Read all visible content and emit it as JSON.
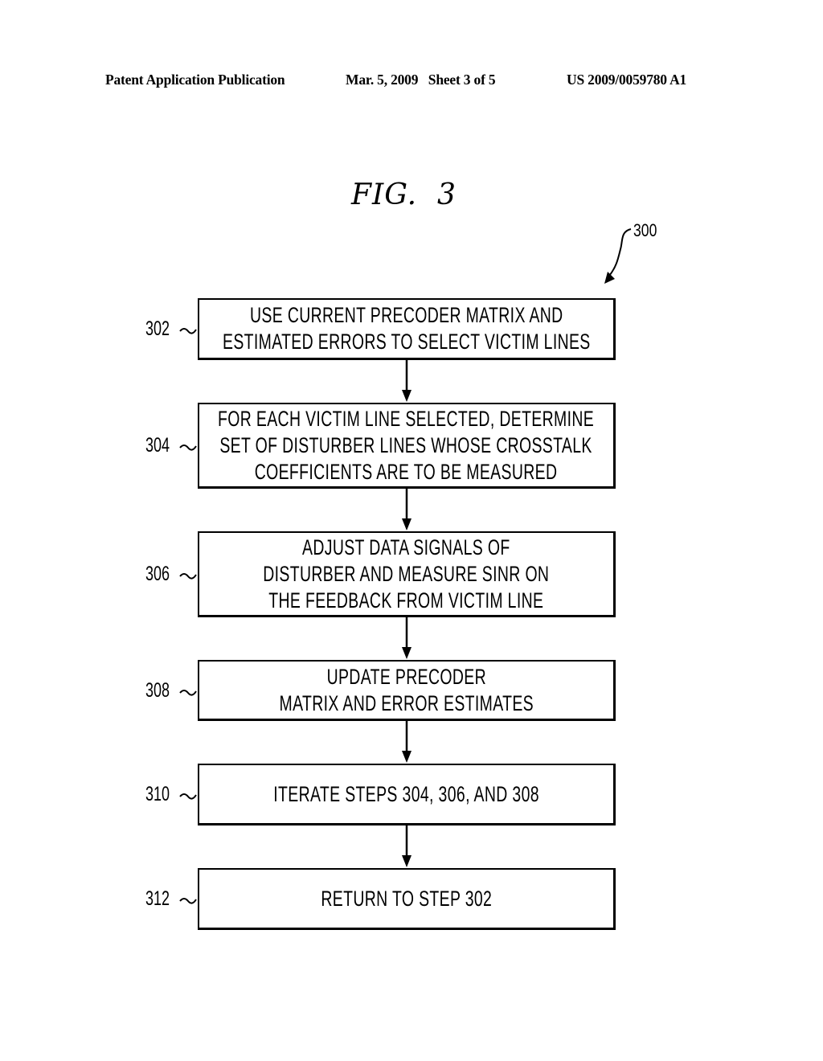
{
  "header": {
    "left": "Patent Application Publication",
    "middle": "Mar. 5, 2009   Sheet 3 of 5",
    "right": "US 2009/0059780 A1"
  },
  "figure": {
    "title": "FIG.  3",
    "reference": "300"
  },
  "steps": [
    {
      "id": "302",
      "lines": [
        "USE CURRENT PRECODER MATRIX AND",
        "ESTIMATED ERRORS TO SELECT VICTIM LINES"
      ]
    },
    {
      "id": "304",
      "lines": [
        "FOR EACH VICTIM LINE SELECTED, DETERMINE",
        "SET OF DISTURBER LINES WHOSE CROSSTALK",
        "COEFFICIENTS ARE TO BE MEASURED"
      ]
    },
    {
      "id": "306",
      "lines": [
        "ADJUST DATA SIGNALS OF",
        "DISTURBER AND MEASURE SINR ON",
        "THE FEEDBACK FROM VICTIM LINE"
      ]
    },
    {
      "id": "308",
      "lines": [
        "UPDATE PRECODER",
        "MATRIX AND ERROR ESTIMATES"
      ]
    },
    {
      "id": "310",
      "lines": [
        "ITERATE STEPS 304, 306, AND 308"
      ]
    },
    {
      "id": "312",
      "lines": [
        "RETURN TO STEP 302"
      ]
    }
  ]
}
